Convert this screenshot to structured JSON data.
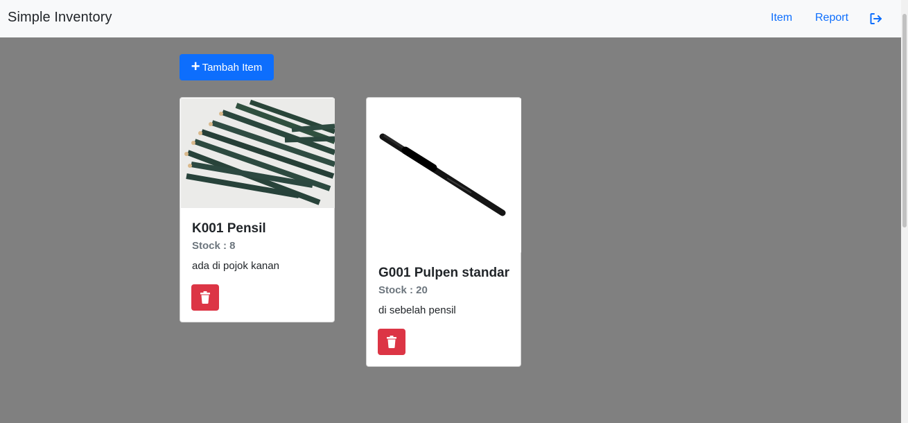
{
  "navbar": {
    "brand": "Simple Inventory",
    "links": [
      {
        "label": "Item"
      },
      {
        "label": "Report"
      }
    ],
    "logout_icon": "sign-out-icon",
    "link_color": "#0d6efd"
  },
  "toolbar": {
    "add_label": "Tambah Item",
    "add_icon": "plus-icon"
  },
  "items": [
    {
      "code_name": "K001 Pensil",
      "stock": "Stock : 8",
      "description": "ada di pojok kanan",
      "image_icon": "pencils-photo",
      "delete_icon": "trash-icon"
    },
    {
      "code_name": "G001 Pulpen standar",
      "stock": "Stock : 20",
      "description": "di sebelah pensil",
      "image_icon": "pen-photo",
      "delete_icon": "trash-icon"
    }
  ],
  "colors": {
    "background": "#808080",
    "primary": "#0d6efd",
    "danger": "#dc3545",
    "muted": "#6c757d"
  }
}
